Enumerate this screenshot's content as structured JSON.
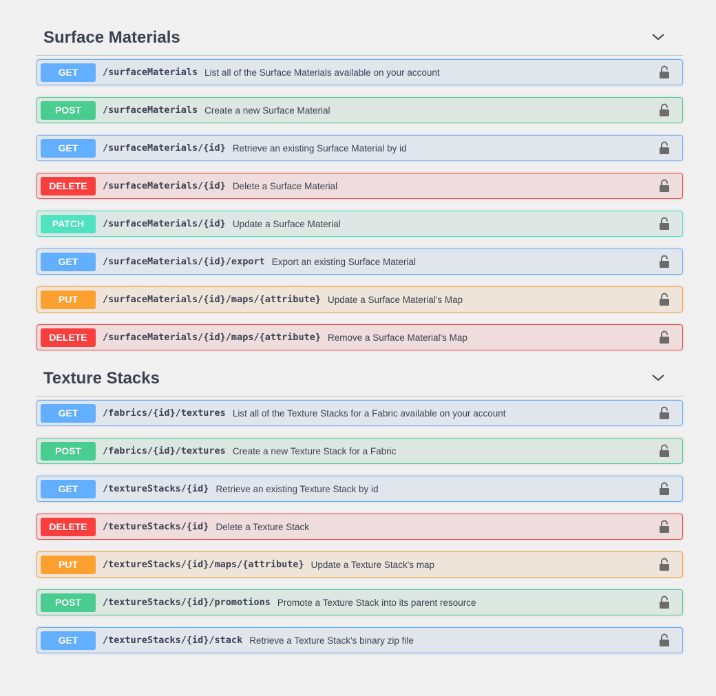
{
  "icon_names": {
    "section_toggle": "chevron-down-icon",
    "authorization": "lock-icon"
  },
  "colors": {
    "get": "#61affe",
    "post": "#49cc90",
    "delete": "#f93e3e",
    "patch": "#50e3c2",
    "put": "#fca130",
    "text": "#3b4151",
    "lock": "#6b6b6b"
  },
  "sections": [
    {
      "title": "Surface Materials",
      "operations": [
        {
          "method": "GET",
          "path": "/surfaceMaterials",
          "summary": "List all of the Surface Materials available on your account"
        },
        {
          "method": "POST",
          "path": "/surfaceMaterials",
          "summary": "Create a new Surface Material"
        },
        {
          "method": "GET",
          "path": "/surfaceMaterials/{id}",
          "summary": "Retrieve an existing Surface Material by id"
        },
        {
          "method": "DELETE",
          "path": "/surfaceMaterials/{id}",
          "summary": "Delete a Surface Material"
        },
        {
          "method": "PATCH",
          "path": "/surfaceMaterials/{id}",
          "summary": "Update a Surface Material"
        },
        {
          "method": "GET",
          "path": "/surfaceMaterials/{id}/export",
          "summary": "Export an existing Surface Material"
        },
        {
          "method": "PUT",
          "path": "/surfaceMaterials/{id}/maps/{attribute}",
          "summary": "Update a Surface Material's Map"
        },
        {
          "method": "DELETE",
          "path": "/surfaceMaterials/{id}/maps/{attribute}",
          "summary": "Remove a Surface Material's Map"
        }
      ]
    },
    {
      "title": "Texture Stacks",
      "operations": [
        {
          "method": "GET",
          "path": "/fabrics/{id}/textures",
          "summary": "List all of the Texture Stacks for a Fabric available on your account"
        },
        {
          "method": "POST",
          "path": "/fabrics/{id}/textures",
          "summary": "Create a new Texture Stack for a Fabric"
        },
        {
          "method": "GET",
          "path": "/textureStacks/{id}",
          "summary": "Retrieve an existing Texture Stack by id"
        },
        {
          "method": "DELETE",
          "path": "/textureStacks/{id}",
          "summary": "Delete a Texture Stack"
        },
        {
          "method": "PUT",
          "path": "/textureStacks/{id}/maps/{attribute}",
          "summary": "Update a Texture Stack's map"
        },
        {
          "method": "POST",
          "path": "/textureStacks/{id}/promotions",
          "summary": "Promote a Texture Stack into its parent resource"
        },
        {
          "method": "GET",
          "path": "/textureStacks/{id}/stack",
          "summary": "Retrieve a Texture Stack's binary zip file"
        }
      ]
    }
  ]
}
